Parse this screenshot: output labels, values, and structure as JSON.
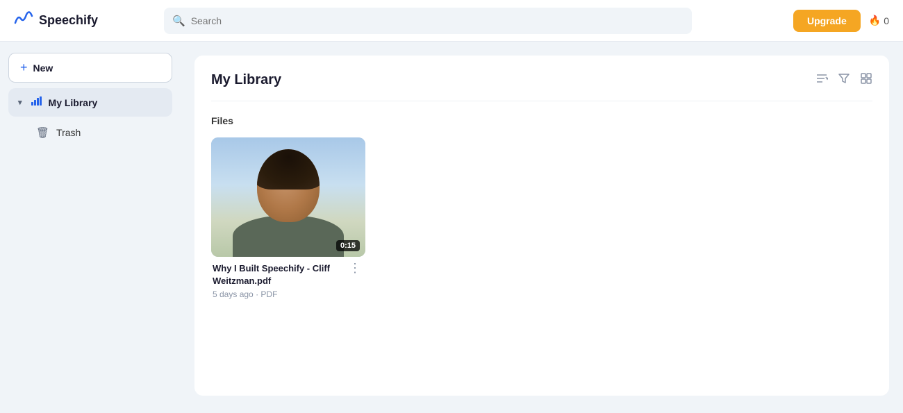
{
  "header": {
    "logo_text": "Speechify",
    "search_placeholder": "Search",
    "upgrade_label": "Upgrade",
    "fire_count": "0"
  },
  "sidebar": {
    "new_label": "New",
    "items": [
      {
        "id": "my-library",
        "label": "My Library",
        "active": true,
        "icon": "chart"
      },
      {
        "id": "trash",
        "label": "Trash",
        "active": false,
        "icon": "trash"
      }
    ]
  },
  "main": {
    "title": "My Library",
    "section_label": "Files",
    "files": [
      {
        "id": "file-1",
        "name": "Why I Built Speechify - Cliff Weitzman.pdf",
        "age": "5 days ago",
        "type": "PDF",
        "duration": "0:15"
      }
    ]
  },
  "toolbar": {
    "sort_icon": "≡↓",
    "filter_icon": "▽",
    "grid_icon": "⊞"
  }
}
